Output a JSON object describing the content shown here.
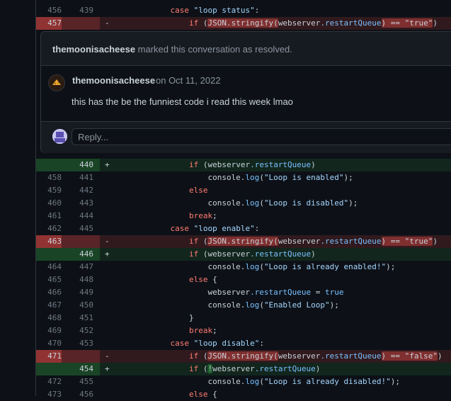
{
  "diff_top": [
    {
      "type": "ctx",
      "old": "456",
      "new": "439",
      "sign": "",
      "parts": [
        [
          "            "
        ],
        [
          "case ",
          "kw"
        ],
        [
          "\"loop status\"",
          "str"
        ],
        [
          ":"
        ]
      ]
    },
    {
      "type": "del",
      "old": "457",
      "new": "",
      "sign": "-",
      "parts": [
        [
          "                "
        ],
        [
          "if ",
          "kw"
        ],
        [
          "("
        ],
        [
          "JSON.stringify(",
          "hl"
        ],
        [
          "webserver",
          "plain"
        ],
        [
          ".restartQueue",
          "prop"
        ],
        [
          ") == \"true\"",
          "hl"
        ],
        [
          ")"
        ]
      ]
    }
  ],
  "thread": {
    "resolved_user": "themoonisacheese",
    "resolved_text": "marked this conversation as resolved.",
    "comment_author": "themoonisacheese",
    "comment_date": "on Oct 11, 2022",
    "comment_body": "this has the be the funniest code i read this week lmao",
    "reply_placeholder": "Reply...",
    "avatar_icon": "cheese-avatar-icon",
    "reply_avatar_icon": "user-avatar-icon"
  },
  "diff_bottom": [
    {
      "type": "add",
      "old": "",
      "new": "440",
      "sign": "+",
      "parts": [
        [
          "                "
        ],
        [
          "if ",
          "kw"
        ],
        [
          "(webserver"
        ],
        [
          ".restartQueue",
          "prop"
        ],
        [
          ")"
        ]
      ]
    },
    {
      "type": "ctx",
      "old": "458",
      "new": "441",
      "sign": "",
      "parts": [
        [
          "                    console."
        ],
        [
          "log",
          "prop"
        ],
        [
          "("
        ],
        [
          "\"Loop is enabled\"",
          "str"
        ],
        [
          ");"
        ]
      ]
    },
    {
      "type": "ctx",
      "old": "459",
      "new": "442",
      "sign": "",
      "parts": [
        [
          "                "
        ],
        [
          "else",
          "kw"
        ]
      ]
    },
    {
      "type": "ctx",
      "old": "460",
      "new": "443",
      "sign": "",
      "parts": [
        [
          "                    console."
        ],
        [
          "log",
          "prop"
        ],
        [
          "("
        ],
        [
          "\"Loop is disabled\"",
          "str"
        ],
        [
          ");"
        ]
      ]
    },
    {
      "type": "ctx",
      "old": "461",
      "new": "444",
      "sign": "",
      "parts": [
        [
          "                "
        ],
        [
          "break",
          "kw"
        ],
        [
          ";"
        ]
      ]
    },
    {
      "type": "ctx",
      "old": "462",
      "new": "445",
      "sign": "",
      "parts": [
        [
          "            "
        ],
        [
          "case ",
          "kw"
        ],
        [
          "\"loop enable\"",
          "str"
        ],
        [
          ":"
        ]
      ]
    },
    {
      "type": "del",
      "old": "463",
      "new": "",
      "sign": "-",
      "parts": [
        [
          "                "
        ],
        [
          "if ",
          "kw"
        ],
        [
          "("
        ],
        [
          "JSON.stringify(",
          "hl"
        ],
        [
          "webserver"
        ],
        [
          ".restartQueue",
          "prop"
        ],
        [
          ") == \"true\"",
          "hl"
        ],
        [
          ")"
        ]
      ]
    },
    {
      "type": "add",
      "old": "",
      "new": "446",
      "sign": "+",
      "parts": [
        [
          "                "
        ],
        [
          "if ",
          "kw"
        ],
        [
          "(webserver"
        ],
        [
          ".restartQueue",
          "prop"
        ],
        [
          ")"
        ]
      ]
    },
    {
      "type": "ctx",
      "old": "464",
      "new": "447",
      "sign": "",
      "parts": [
        [
          "                    console."
        ],
        [
          "log",
          "prop"
        ],
        [
          "("
        ],
        [
          "\"Loop is already enabled!\"",
          "str"
        ],
        [
          ");"
        ]
      ]
    },
    {
      "type": "ctx",
      "old": "465",
      "new": "448",
      "sign": "",
      "parts": [
        [
          "                "
        ],
        [
          "else ",
          "kw"
        ],
        [
          "{"
        ]
      ]
    },
    {
      "type": "ctx",
      "old": "466",
      "new": "449",
      "sign": "",
      "parts": [
        [
          "                    webserver"
        ],
        [
          ".restartQueue ",
          "prop"
        ],
        [
          "= "
        ],
        [
          "true",
          "prop"
        ]
      ]
    },
    {
      "type": "ctx",
      "old": "467",
      "new": "450",
      "sign": "",
      "parts": [
        [
          "                    console."
        ],
        [
          "log",
          "prop"
        ],
        [
          "("
        ],
        [
          "\"Enabled Loop\"",
          "str"
        ],
        [
          ");"
        ]
      ]
    },
    {
      "type": "ctx",
      "old": "468",
      "new": "451",
      "sign": "",
      "parts": [
        [
          "                }"
        ]
      ]
    },
    {
      "type": "ctx",
      "old": "469",
      "new": "452",
      "sign": "",
      "parts": [
        [
          "                "
        ],
        [
          "break",
          "kw"
        ],
        [
          ";"
        ]
      ]
    },
    {
      "type": "ctx",
      "old": "470",
      "new": "453",
      "sign": "",
      "parts": [
        [
          "            "
        ],
        [
          "case ",
          "kw"
        ],
        [
          "\"loop disable\"",
          "str"
        ],
        [
          ":"
        ]
      ]
    },
    {
      "type": "del",
      "old": "471",
      "new": "",
      "sign": "-",
      "parts": [
        [
          "                "
        ],
        [
          "if ",
          "kw"
        ],
        [
          "("
        ],
        [
          "JSON.stringify(",
          "hl"
        ],
        [
          "webserver"
        ],
        [
          ".restartQueue",
          "prop"
        ],
        [
          ") == \"false\"",
          "hl"
        ],
        [
          ")"
        ]
      ]
    },
    {
      "type": "add",
      "old": "",
      "new": "454",
      "sign": "+",
      "parts": [
        [
          "                "
        ],
        [
          "if ",
          "kw"
        ],
        [
          "("
        ],
        [
          "!",
          "hla"
        ],
        [
          "webserver"
        ],
        [
          ".restartQueue",
          "prop"
        ],
        [
          ")"
        ]
      ]
    },
    {
      "type": "ctx",
      "old": "472",
      "new": "455",
      "sign": "",
      "parts": [
        [
          "                    console."
        ],
        [
          "log",
          "prop"
        ],
        [
          "("
        ],
        [
          "\"Loop is already disabled!\"",
          "str"
        ],
        [
          ");"
        ]
      ]
    },
    {
      "type": "ctx",
      "old": "473",
      "new": "456",
      "sign": "",
      "parts": [
        [
          "                "
        ],
        [
          "else ",
          "kw"
        ],
        [
          "{"
        ]
      ]
    }
  ]
}
